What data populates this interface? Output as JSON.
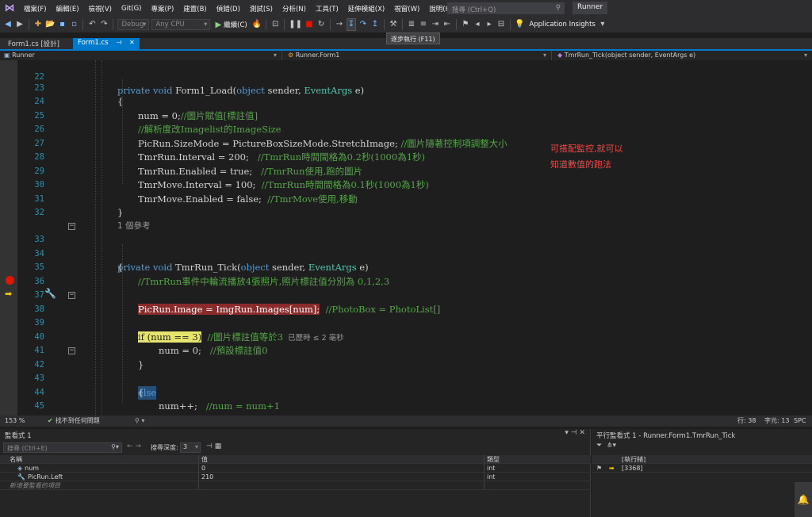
{
  "menu": {
    "items": [
      "檔案(F)",
      "編輯(E)",
      "檢視(V)",
      "Git(G)",
      "專案(P)",
      "建置(B)",
      "偵錯(D)",
      "測試(S)",
      "分析(N)",
      "工具(T)",
      "延伸模組(X)",
      "視窗(W)",
      "說明(H)"
    ],
    "search_placeholder": "搜尋 (Ctrl+Q)",
    "solution_name": "Runner"
  },
  "toolbar": {
    "config": "Debug",
    "platform": "Any CPU",
    "continue_label": "繼續(C)",
    "app_insights": "Application Insights",
    "tooltip": "逐步執行 (F11)"
  },
  "tabs": [
    {
      "label": "Form1.cs [設計]"
    },
    {
      "label": "Form1.cs"
    }
  ],
  "navbar": {
    "project": "Runner",
    "class": "Runner.Form1",
    "member": "TmrRun_Tick(object sender, EventArgs e)"
  },
  "editor": {
    "lines": [
      {
        "n": "22",
        "code": "private void Form1_Load(object sender, EventArgs e)"
      },
      {
        "n": "23",
        "code": "{"
      },
      {
        "n": "24",
        "code": "num = 0;",
        "comment": "//圖片賦值[標註值]"
      },
      {
        "n": "25",
        "code": "",
        "comment": "//解析度改Imagelist的ImageSize"
      },
      {
        "n": "26",
        "code": "PicRun.SizeMode = PictureBoxSizeMode.StretchImage;",
        "comment": " //圖片隨著控制項調整大小"
      },
      {
        "n": "27",
        "code": "TmrRun.Interval = 200;",
        "comment": "   //TmrRun時間間格為0.2秒(1000為1秒)"
      },
      {
        "n": "28",
        "code": "TmrRun.Enabled = true;",
        "comment": "   //TmrRun使用,跑的圖片"
      },
      {
        "n": "29",
        "code": "TmrMove.Interval = 100;",
        "comment": "  //TmrRun時間間格為0.1秒(1000為1秒)"
      },
      {
        "n": "30",
        "code": "TmrMove.Enabled = false;",
        "comment": "  //TmrMove使用,移動"
      },
      {
        "n": "31",
        "code": "}"
      },
      {
        "n": "32",
        "code": ""
      },
      {
        "n": "",
        "ref": "1 個參考"
      },
      {
        "n": "33",
        "code": "private void TmrRun_Tick(object sender, EventArgs e)"
      },
      {
        "n": "34",
        "code": "{"
      },
      {
        "n": "35",
        "code": "",
        "comment": "//TmrRun事件中輪流播放4張照片,照片標註值分別為 0,1,2,3"
      },
      {
        "n": "36",
        "code": ""
      },
      {
        "n": "37",
        "code": "PicRun.Image = ImgRun.Images[num];",
        "comment": "  //PhotoBox = PhotoList[]"
      },
      {
        "n": "38",
        "code": "if (num == 3)",
        "comment": "  //圖片標註值等於3",
        "elapsed": "已歷時 ≤ 2 毫秒"
      },
      {
        "n": "39",
        "code": "{"
      },
      {
        "n": "40",
        "code": "num = 0;",
        "comment": "   //預設標註值0"
      },
      {
        "n": "41",
        "code": "}"
      },
      {
        "n": "42",
        "code": "else"
      },
      {
        "n": "43",
        "code": "{"
      },
      {
        "n": "44",
        "code": "num++;",
        "comment": "   //num = num+1"
      },
      {
        "n": "45",
        "code": "}"
      },
      {
        "n": "46",
        "code": "}"
      }
    ],
    "annotation": [
      "可搭配監控,就可以",
      "知道數值的跑法"
    ]
  },
  "status": {
    "zoom": "153 %",
    "issues": "找不到任何問題",
    "row": "行: 38",
    "col": "字元: 13",
    "mode": "SPC"
  },
  "watch": {
    "title": "監看式 1",
    "search_placeholder": "搜尋 (Ctrl+E)",
    "depth_label": "搜尋深度:",
    "depth_value": "3",
    "headers": {
      "name": "名稱",
      "value": "值",
      "type": "類型"
    },
    "rows": [
      {
        "name": "num",
        "value": "0",
        "type": "int"
      },
      {
        "name": "PicRun.Left",
        "value": "210",
        "type": "int"
      }
    ],
    "add_prompt": "新增要監看的項目"
  },
  "parallel": {
    "title": "平行監看式 1 - Runner.Form1.TmrRun_Tick",
    "header": "[執行緒]",
    "thread": "[3368]"
  }
}
